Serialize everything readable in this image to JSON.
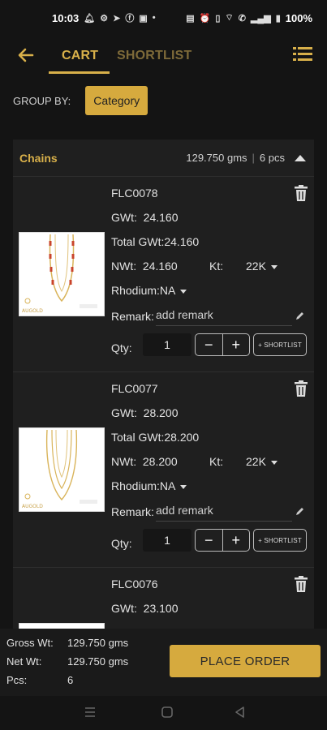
{
  "status_bar": {
    "time": "10:03",
    "battery": "100%",
    "left_icons": [
      "bell-icon",
      "settings-icon",
      "telegram-icon",
      "facebook-icon",
      "app-icon"
    ],
    "right_icons": [
      "nfc-icon",
      "alarm-icon",
      "vibrate-icon",
      "wifi-icon",
      "call-icon",
      "signal-icon",
      "battery-icon"
    ]
  },
  "header": {
    "back_icon": "arrow-left-icon",
    "tabs": [
      {
        "label": "CART",
        "active": true
      },
      {
        "label": "SHORTLIST",
        "active": false
      }
    ],
    "menu_icon": "list-menu-icon",
    "accent_color": "#d8b04a"
  },
  "group_by": {
    "label": "GROUP BY:",
    "value": "Category"
  },
  "section": {
    "title": "Chains",
    "weight": "129.750 gms",
    "pieces": "6 pcs"
  },
  "labels": {
    "gwt": "GWt:",
    "total_gwt": "Total GWt:",
    "nwt": "NWt:",
    "kt": "Kt:",
    "rhodium": "Rhodium:",
    "remark": "Remark:",
    "remark_placeholder": "add remark",
    "qty": "Qty:",
    "minus": "−",
    "plus": "+",
    "shortlist": "+ SHORTLIST"
  },
  "items": [
    {
      "code": "FLC0078",
      "gwt": "24.160",
      "total_gwt": "24.160",
      "nwt": "24.160",
      "kt": "22K",
      "rhodium": "NA",
      "qty": "1",
      "brand": "AUGOLD"
    },
    {
      "code": "FLC0077",
      "gwt": "28.200",
      "total_gwt": "28.200",
      "nwt": "28.200",
      "kt": "22K",
      "rhodium": "NA",
      "qty": "1",
      "brand": "AUGOLD"
    },
    {
      "code": "FLC0076",
      "gwt": "23.100"
    }
  ],
  "footer": {
    "gross_label": "Gross Wt:",
    "gross_value": "129.750 gms",
    "net_label": "Net Wt:",
    "net_value": "129.750 gms",
    "pcs_label": "Pcs:",
    "pcs_value": "6",
    "place_order": "PLACE ORDER"
  },
  "nav_bar": [
    "recents-icon",
    "home-icon",
    "back-icon"
  ]
}
